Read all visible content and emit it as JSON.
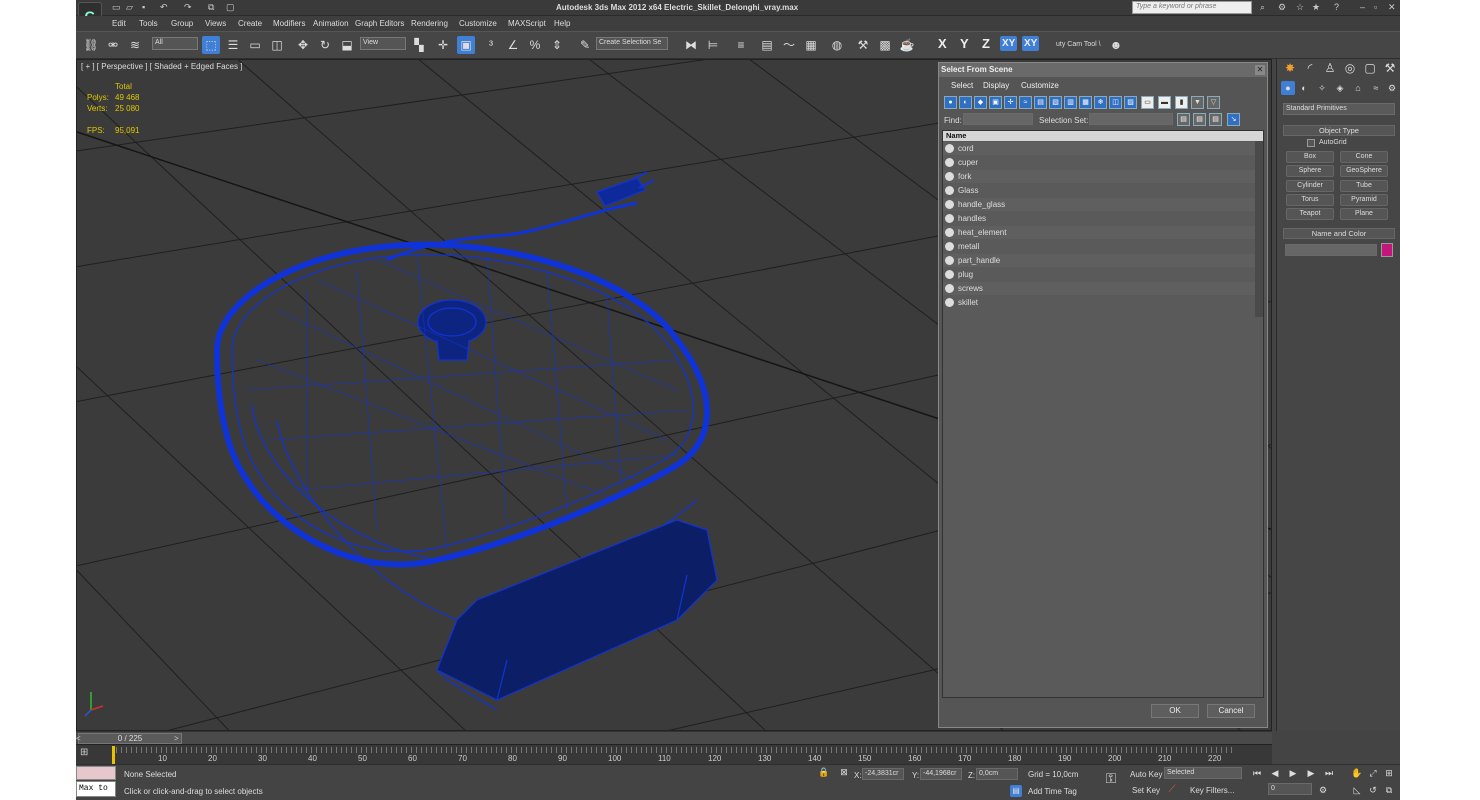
{
  "app": {
    "title": "Autodesk 3ds Max  2012 x64     Electric_Skillet_Delonghi_vray.max",
    "search_placeholder": "Type a keyword or phrase"
  },
  "menu": [
    "Edit",
    "Tools",
    "Group",
    "Views",
    "Create",
    "Modifiers",
    "Animation",
    "Graph Editors",
    "Rendering",
    "Customize",
    "MAXScript",
    "Help"
  ],
  "toolbar": {
    "filter": "All",
    "refcoord": "View",
    "selection_set": "Create Selection Se",
    "axes": [
      "X",
      "Y",
      "Z",
      "XY",
      "XY"
    ],
    "cam_tool": "uty Cam Tool \\"
  },
  "viewport": {
    "label": "[ + ] [ Perspective ] [ Shaded + Edged Faces ]",
    "stats_header": "Total",
    "polys_label": "Polys:",
    "polys": "49 468",
    "verts_label": "Verts:",
    "verts": "25 080",
    "fps_label": "FPS:",
    "fps": "95,091",
    "wire_color": "#1033d8"
  },
  "dialog": {
    "title": "Select From Scene",
    "menus": [
      "Select",
      "Display",
      "Customize"
    ],
    "find_label": "Find:",
    "selset_label": "Selection Set:",
    "column": "Name",
    "items": [
      "cord",
      "cuper",
      "fork",
      "Glass",
      "handle_glass",
      "handles",
      "heat_element",
      "metall",
      "part_handle",
      "plug",
      "screws",
      "skillet"
    ],
    "ok": "OK",
    "cancel": "Cancel"
  },
  "command_panel": {
    "dropdown": "Standard Primitives",
    "object_type": "Object Type",
    "autogrid": "AutoGrid",
    "buttons": [
      "Box",
      "Cone",
      "Sphere",
      "GeoSphere",
      "Cylinder",
      "Tube",
      "Torus",
      "Pyramid",
      "Teapot",
      "Plane"
    ],
    "name_and_color": "Name and Color",
    "color_swatch": "#c2177a"
  },
  "timeline": {
    "frame": "0 / 225",
    "ticks": [
      "10",
      "20",
      "30",
      "40",
      "50",
      "60",
      "70",
      "80",
      "90",
      "100",
      "110",
      "120",
      "130",
      "140",
      "150",
      "160",
      "170",
      "180",
      "190",
      "200",
      "210",
      "220"
    ]
  },
  "status": {
    "maxscript": "Max to",
    "selection": "None Selected",
    "prompt": "Click or click-and-drag to select objects",
    "x_label": "X:",
    "x": "-24,3831cr",
    "y_label": "Y:",
    "y": "-44,1968cr",
    "z_label": "Z:",
    "z": "0,0cm",
    "grid": "Grid = 10,0cm",
    "add_time_tag": "Add Time Tag",
    "auto_key": "Auto Key",
    "set_key": "Set Key",
    "selected": "Selected",
    "key_filters": "Key Filters...",
    "frame_field": "0"
  }
}
